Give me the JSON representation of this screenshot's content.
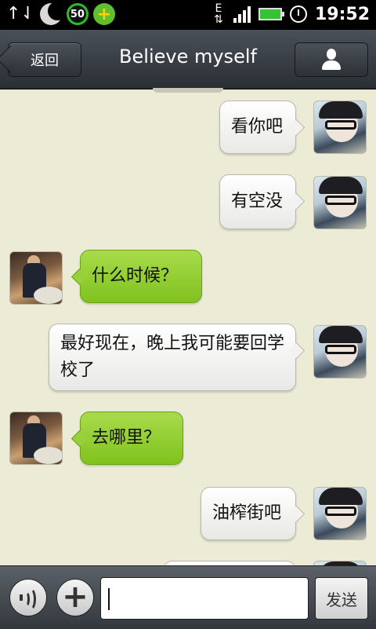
{
  "status_bar": {
    "battery_level": "50",
    "network_type": "E",
    "time": "19:52"
  },
  "header": {
    "back_label": "返回",
    "title": "Believe myself"
  },
  "messages": [
    {
      "side": "out",
      "text": "看你吧"
    },
    {
      "side": "out",
      "text": "有空没"
    },
    {
      "side": "in",
      "text": "什么时候？"
    },
    {
      "side": "out",
      "text": "最好现在，晚上我可能要回学校了"
    },
    {
      "side": "in",
      "text": "去哪里？"
    },
    {
      "side": "out",
      "text": "油榨街吧"
    }
  ],
  "composer": {
    "input_value": "",
    "send_label": "发送"
  },
  "icons": {
    "status_left": [
      "data-transfer-icon",
      "weather-icon",
      "battery-saver-icon",
      "security-plus-icon"
    ],
    "status_right": [
      "network-icon",
      "signal-icon",
      "battery-icon",
      "alarm-icon"
    ],
    "header": [
      "back-arrow",
      "user-icon"
    ],
    "composer": [
      "voice-icon",
      "plus-icon"
    ]
  },
  "colors": {
    "background": "#ecebd6",
    "incoming_bubble": "#8fcb2f",
    "outgoing_bubble": "#f2f2f0",
    "header": "#33383e"
  }
}
